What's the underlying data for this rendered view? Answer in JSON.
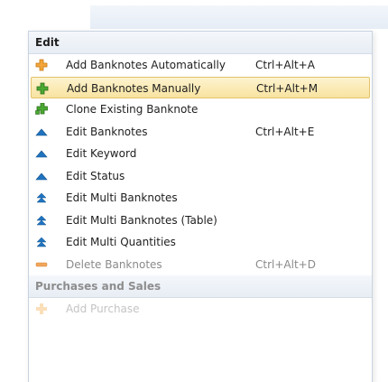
{
  "menu": {
    "section_title": "Edit",
    "items": [
      {
        "label": "Add Banknotes Automatically",
        "shortcut": "Ctrl+Alt+A",
        "icon": "plus-orange-icon"
      },
      {
        "label": "Add Banknotes Manually",
        "shortcut": "Ctrl+Alt+M",
        "icon": "plus-green-icon",
        "highlighted": true
      },
      {
        "label": "Clone Existing Banknote",
        "shortcut": "",
        "icon": "plus-green-clone-icon"
      },
      {
        "label": "Edit Banknotes",
        "shortcut": "Ctrl+Alt+E",
        "icon": "edit-blue-icon"
      },
      {
        "label": "Edit Keyword",
        "shortcut": "",
        "icon": "edit-blue-icon"
      },
      {
        "label": "Edit Status",
        "shortcut": "",
        "icon": "edit-blue-icon"
      },
      {
        "label": "Edit Multi Banknotes",
        "shortcut": "",
        "icon": "edit-multi-icon"
      },
      {
        "label": "Edit Multi Banknotes (Table)",
        "shortcut": "",
        "icon": "edit-multi-icon"
      },
      {
        "label": "Edit Multi Quantities",
        "shortcut": "",
        "icon": "edit-multi-icon"
      },
      {
        "label": "Delete Banknotes",
        "shortcut": "Ctrl+Alt+D",
        "icon": "minus-orange-icon",
        "disabled": true
      }
    ],
    "second_section_title": "Purchases and Sales",
    "partial_item_label": "Add Purchase"
  },
  "colors": {
    "highlight": "#f8e3a0",
    "orange": "#f0a030",
    "green": "#3f9a2a",
    "blue": "#1e6fb8"
  }
}
